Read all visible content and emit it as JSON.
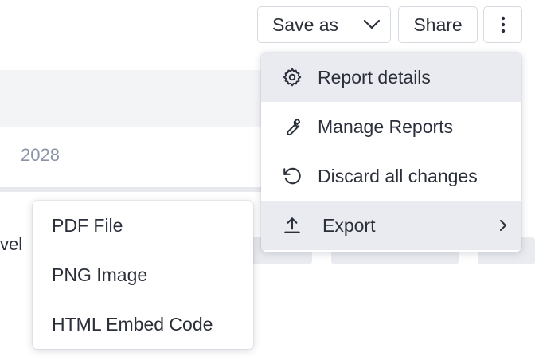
{
  "toolbar": {
    "save_as_label": "Save as",
    "share_label": "Share"
  },
  "report_table": {
    "year_cell": "2028",
    "level_label": "vel"
  },
  "main_menu": {
    "items": [
      {
        "label": "Report details",
        "icon": "gear-icon",
        "highlighted": true
      },
      {
        "label": "Manage Reports",
        "icon": "wrench-icon"
      },
      {
        "label": "Discard all changes",
        "icon": "undo-icon"
      },
      {
        "label": "Export",
        "icon": "upload-icon",
        "highlighted": true,
        "has_submenu": true
      }
    ]
  },
  "export_submenu": {
    "items": [
      {
        "label": "PDF File"
      },
      {
        "label": "PNG Image"
      },
      {
        "label": "HTML Embed Code"
      }
    ]
  },
  "colors": {
    "highlight": "#e9ebf0",
    "text": "#2b2f3a",
    "muted_text": "#8a93a6",
    "border": "#d6d9df"
  }
}
